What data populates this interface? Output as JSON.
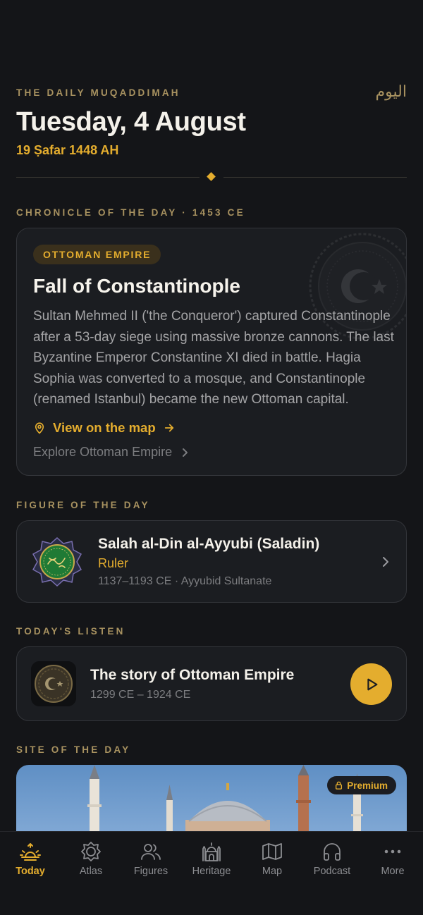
{
  "header": {
    "kicker": "THE DAILY MUQADDIMAH",
    "arabic_today": "اليوم",
    "date": "Tuesday, 4 August",
    "hijri_date": "19 Ṣafar 1448 AH"
  },
  "chronicle": {
    "section_label": "CHRONICLE OF THE DAY · 1453 CE",
    "badge": "OTTOMAN EMPIRE",
    "title": "Fall of Constantinople",
    "body": "Sultan Mehmed II ('the Conqueror') captured Constantinople after a 53-day siege using massive bronze cannons. The last Byzantine Emperor Constantine XI died in battle. Hagia Sophia was converted to a mosque, and Constantinople (renamed Istanbul) became the new Ottoman capital.",
    "map_link": "View on the map",
    "explore_link": "Explore Ottoman Empire"
  },
  "figure": {
    "section_label": "FIGURE OF THE DAY",
    "name": "Salah al-Din al-Ayyubi (Saladin)",
    "role": "Ruler",
    "meta": "1137–1193 CE · Ayyubid Sultanate"
  },
  "listen": {
    "section_label": "TODAY'S LISTEN",
    "title": "The story of Ottoman Empire",
    "meta": "1299 CE – 1924 CE"
  },
  "site": {
    "section_label": "SITE OF THE DAY",
    "badge": "Premium"
  },
  "tabs": [
    {
      "label": "Today",
      "icon": "sunrise-icon",
      "active": true
    },
    {
      "label": "Atlas",
      "icon": "compass-icon",
      "active": false
    },
    {
      "label": "Figures",
      "icon": "users-icon",
      "active": false
    },
    {
      "label": "Heritage",
      "icon": "mosque-icon",
      "active": false
    },
    {
      "label": "Map",
      "icon": "map-icon",
      "active": false
    },
    {
      "label": "Podcast",
      "icon": "headphones-icon",
      "active": false
    },
    {
      "label": "More",
      "icon": "more-icon",
      "active": false
    }
  ],
  "colors": {
    "background": "#141518",
    "card": "#1b1d21",
    "accent": "#e4ad2e",
    "muted_gold": "#a89260"
  }
}
